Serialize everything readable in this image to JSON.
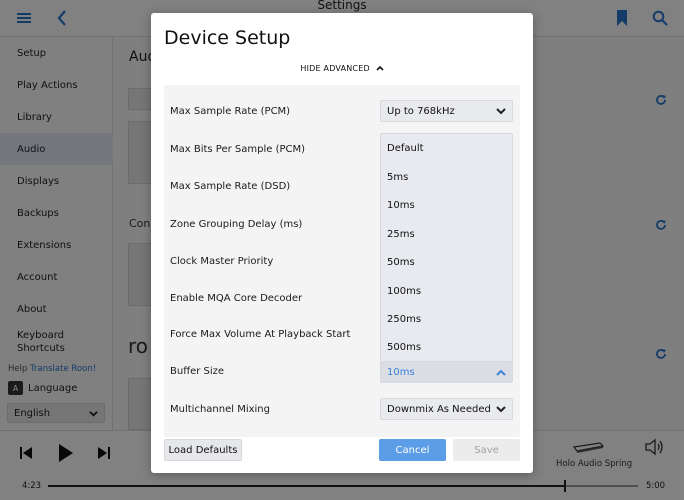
{
  "app": {
    "title": "Settings",
    "sidebar": [
      {
        "label": "Setup"
      },
      {
        "label": "Play Actions"
      },
      {
        "label": "Library"
      },
      {
        "label": "Audio",
        "active": true
      },
      {
        "label": "Displays"
      },
      {
        "label": "Backups"
      },
      {
        "label": "Extensions"
      },
      {
        "label": "Account"
      },
      {
        "label": "About"
      },
      {
        "label": "Keyboard\nShortcuts"
      }
    ],
    "help_prefix": "Help",
    "help_link": "Translate Roon!",
    "language_label": "Language",
    "language_value": "English",
    "content": {
      "heading_audio": "Aud",
      "heading_conn": "Con",
      "heading_ro": "ro"
    },
    "player": {
      "zone_name": "Holo Audio Spring",
      "time_elapsed": "4:23",
      "time_total": "5:00",
      "progress_fraction": 0.876
    }
  },
  "modal": {
    "title": "Device Setup",
    "advanced_toggle": "HIDE ADVANCED",
    "rows": [
      {
        "label": "Max Sample Rate (PCM)",
        "value": "Up to 768kHz"
      },
      {
        "label": "Max Bits Per Sample (PCM)"
      },
      {
        "label": "Max Sample Rate (DSD)"
      },
      {
        "label": "Zone Grouping Delay (ms)"
      },
      {
        "label": "Clock Master Priority"
      },
      {
        "label": "Enable MQA Core Decoder"
      },
      {
        "label": "Force Max Volume At Playback Start"
      },
      {
        "label": "Buffer Size",
        "value": "10ms"
      },
      {
        "label": "Multichannel Mixing",
        "value": "Downmix As Needed"
      }
    ],
    "buffer_options": [
      "Default",
      "5ms",
      "10ms",
      "25ms",
      "50ms",
      "100ms",
      "250ms",
      "500ms"
    ],
    "buttons": {
      "load_defaults": "Load Defaults",
      "cancel": "Cancel",
      "save": "Save"
    }
  },
  "colors": {
    "accent_blue": "#5b9de6",
    "selected_text_blue": "#3b82d9",
    "sidebar_active": "#dfe6f1"
  }
}
